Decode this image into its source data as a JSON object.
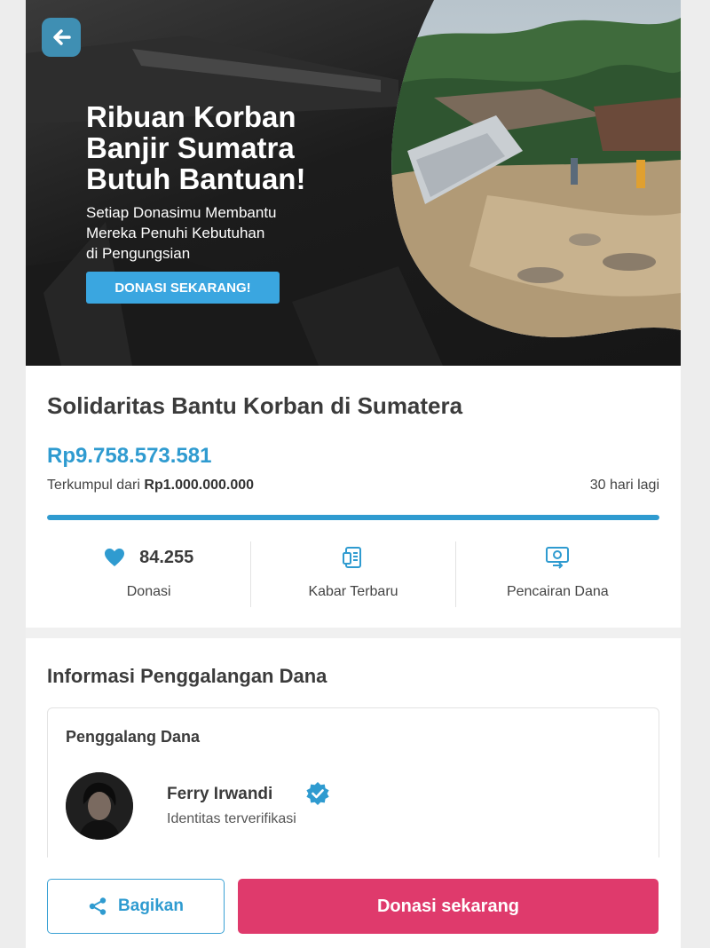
{
  "banner": {
    "headline_lines": [
      "Ribuan Korban",
      "Banjir Sumatra",
      "Butuh Bantuan!"
    ],
    "subline_lines": [
      "Setiap Donasimu Membantu",
      "Mereka Penuhi Kebutuhan",
      "di Pengungsian"
    ],
    "cta_label": "DONASI SEKARANG!",
    "back_icon": "back-arrow-icon"
  },
  "campaign": {
    "title": "Solidaritas Bantu Korban di Sumatera",
    "amount": "Rp9.758.573.581",
    "collected_prefix": "Terkumpul dari",
    "target": "Rp1.000.000.000",
    "days_left": "30 hari lagi",
    "progress_percent": 100
  },
  "stats": {
    "donations": {
      "count": "84.255",
      "label": "Donasi",
      "icon": "heart-icon"
    },
    "updates": {
      "label": "Kabar Terbaru",
      "icon": "news-icon"
    },
    "disbursement": {
      "label": "Pencairan Dana",
      "icon": "withdrawal-icon"
    }
  },
  "info": {
    "section_title": "Informasi Penggalangan Dana",
    "fundraiser_title": "Penggalang Dana",
    "fundraiser_name": "Ferry Irwandi",
    "verification": "Identitas terverifikasi"
  },
  "actions": {
    "share_label": "Bagikan",
    "donate_label": "Donasi sekarang"
  },
  "colors": {
    "accent": "#2f9bd0",
    "donate": "#df3a6c"
  }
}
